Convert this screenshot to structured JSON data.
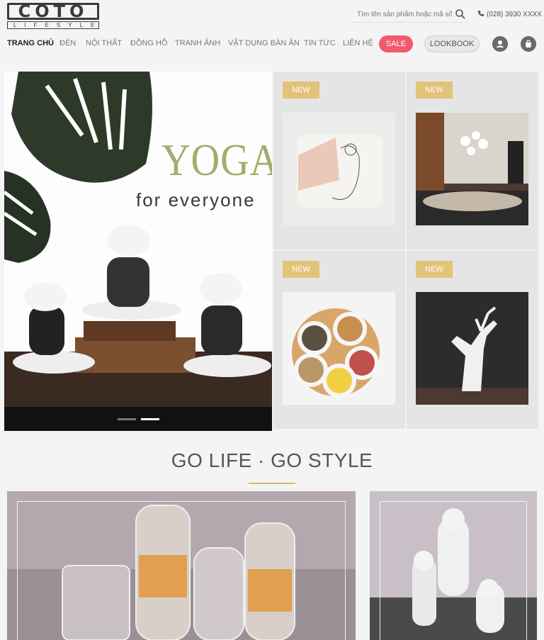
{
  "logo": {
    "main": "COTO",
    "sub": "LIFESYLE"
  },
  "search": {
    "placeholder": "Tìm tên sản phẩm hoặc mã số"
  },
  "phone": "(028) 3930 XXXX",
  "nav": {
    "items": [
      "Trang chủ",
      "Đèn",
      "Nội thất",
      "Đồng hồ",
      "Tranh ảnh",
      "Vật dụng bàn ăn",
      "Tin tức",
      "Liên hệ"
    ],
    "sale": "SALE",
    "lookbook": "LOOKBOOK"
  },
  "hero": {
    "title": "YOGA",
    "subtitle": "for everyone"
  },
  "products": [
    {
      "badge": "NEW",
      "image": "cushion"
    },
    {
      "badge": "NEW",
      "image": "dining-room"
    },
    {
      "badge": "NEW",
      "image": "snack-tray"
    },
    {
      "badge": "NEW",
      "image": "deer-head"
    }
  ],
  "section": {
    "title": "GO LIFE · GO STYLE"
  },
  "colors": {
    "accent": "#d9b86a",
    "sale": "#ef5b6c",
    "badge": "#e3c27a",
    "yoga": "#a1ad6b"
  }
}
